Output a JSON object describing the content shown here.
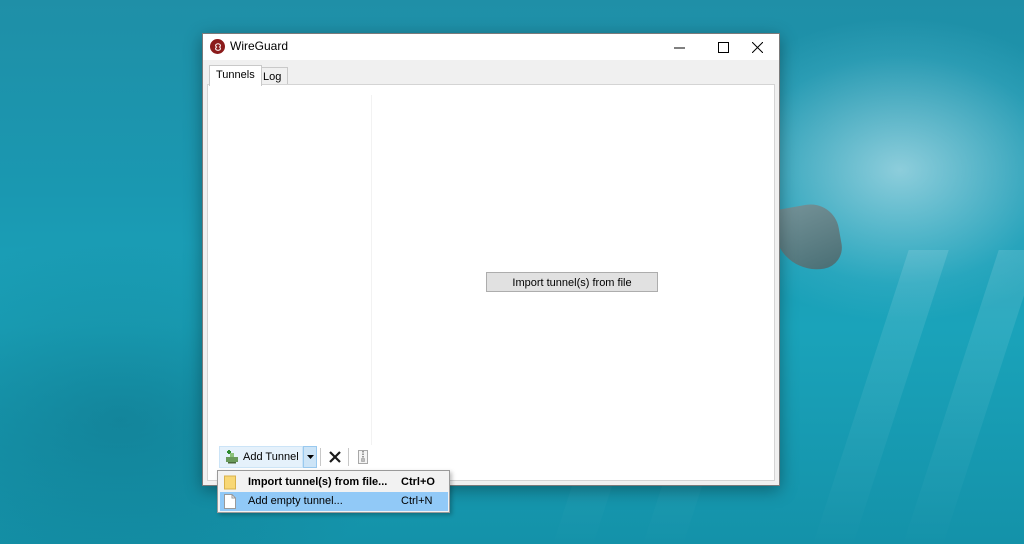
{
  "window": {
    "title": "WireGuard"
  },
  "tabs": [
    {
      "label": "Tunnels",
      "active": true
    },
    {
      "label": "Log",
      "active": false
    }
  ],
  "main": {
    "import_button_label": "Import tunnel(s) from file"
  },
  "toolbar": {
    "add_tunnel_label": "Add Tunnel",
    "icons": {
      "add": "add-tunnel-icon",
      "dropdown": "chevron-down-icon",
      "delete": "delete-icon",
      "export": "export-zip-icon"
    }
  },
  "menu": {
    "items": [
      {
        "label": "Import tunnel(s) from file...",
        "shortcut": "Ctrl+O",
        "icon": "folder-icon",
        "highlighted": false
      },
      {
        "label": "Add empty tunnel...",
        "shortcut": "Ctrl+N",
        "icon": "document-icon",
        "highlighted": true
      }
    ]
  },
  "colors": {
    "menu_highlight": "#91c9f7",
    "button_hover": "#e5f1fb",
    "app_icon": "#8b1b1b"
  }
}
